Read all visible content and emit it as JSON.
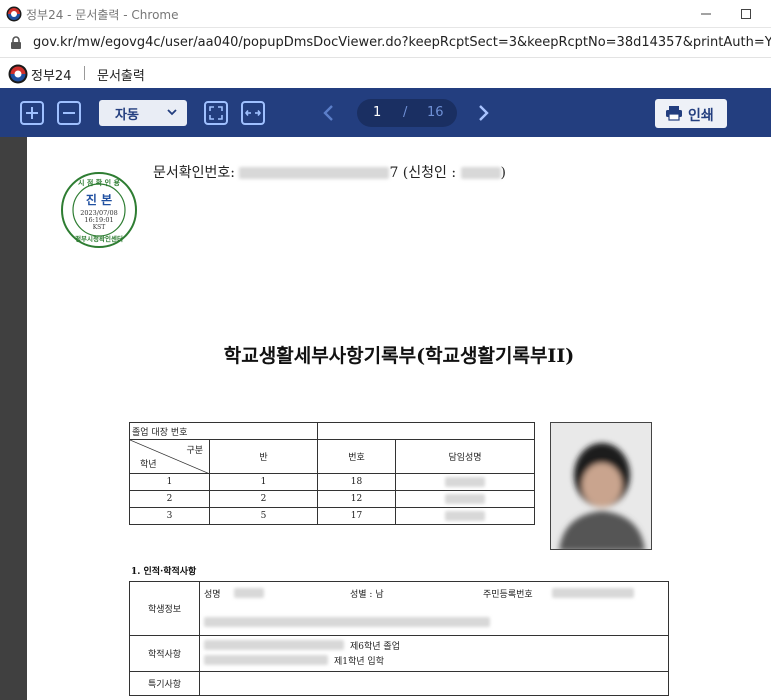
{
  "window": {
    "title": "정부24 - 문서출력 - Chrome"
  },
  "address": {
    "url": "gov.kr/mw/egovg4c/user/aa040/popupDmsDocViewer.do?keepRcptSect=3&keepRcptNo=38d14357&printAuth=Y&w"
  },
  "app": {
    "name": "정부24",
    "section": "문서출력"
  },
  "toolbar": {
    "zoom_value": "자동",
    "current_page": "1",
    "page_sep": "/",
    "total_pages": "16",
    "print_label": "인쇄"
  },
  "document": {
    "doc_no_label": "문서확인번호:",
    "doc_no_suffix": "7 (신청인 :",
    "doc_no_close": ")",
    "stamp": {
      "top": "시 점 확 인 용",
      "center": "진 본",
      "date": "2023/07/08",
      "time": "16:19:01",
      "tz": "KST",
      "bottom": "정부시청확인센터"
    },
    "title": "학교생활세부사항기록부(학교생활기록부II)",
    "grad_header": "졸업 대장 번호",
    "col_gubun": "구분",
    "col_grade": "학년",
    "col_class": "반",
    "col_number": "번호",
    "col_teacher": "담임성명",
    "rows": [
      {
        "grade": "1",
        "class": "1",
        "number": "18"
      },
      {
        "grade": "2",
        "class": "2",
        "number": "12"
      },
      {
        "grade": "3",
        "class": "5",
        "number": "17"
      }
    ],
    "section1": "1. 인적·학적사항",
    "student_info_label": "학생정보",
    "name_label": "성명",
    "gender_label": "성별 : 남",
    "rrn_label": "주민등록번호",
    "academic_label": "학적사항",
    "academic_line1": "제6학년 졸업",
    "academic_line2": "제1학년 입학",
    "special_label": "특기사항"
  },
  "colors": {
    "toolbar_bg": "#233e7f",
    "stamp_green": "#2e7d32",
    "stamp_blue": "#1f4fa0"
  }
}
